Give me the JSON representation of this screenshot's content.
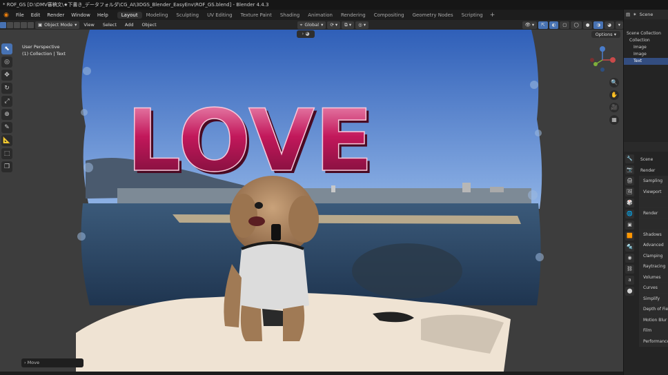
{
  "window": {
    "title": "* ROF_GS [D:\\DMV審稿文\\★下書き_データフォルダ\\CG_AI\\3DGS_Blender_EasyEnv\\ROF_GS.blend] - Blender 4.4.3"
  },
  "menus": [
    "File",
    "Edit",
    "Render",
    "Window",
    "Help"
  ],
  "workspaces": [
    "Layout",
    "Modeling",
    "Sculpting",
    "UV Editing",
    "Texture Paint",
    "Shading",
    "Animation",
    "Rendering",
    "Compositing",
    "Geometry Nodes",
    "Scripting"
  ],
  "active_workspace": "Layout",
  "header": {
    "mode": "Object Mode",
    "menus": [
      "View",
      "Select",
      "Add",
      "Object"
    ],
    "orientation": "Global",
    "options_label": "Options"
  },
  "viewport": {
    "view_name": "User Perspective",
    "collection_info": "(1) Collection | Text",
    "scene_text": "LOVE",
    "last_operator": "Move"
  },
  "outliner": {
    "scene_label": "Scene",
    "rows": [
      "Scene Collection",
      "Collection",
      "Image",
      "Image",
      "Text"
    ]
  },
  "properties": {
    "scene_label": "Scene",
    "rows": [
      "Render",
      "Sampling",
      "Viewport",
      "",
      "Render",
      "",
      "Shadows",
      "Advanced",
      "Clamping",
      "Raytracing",
      "Volumes",
      "Curves",
      "Simplify",
      "Depth of Field",
      "Motion Blur",
      "Film",
      "Performance"
    ]
  },
  "colors": {
    "accent": "#4772b3",
    "love_pink": "#c2185b",
    "sky": "#3f6fc4",
    "water": "#2f4a66"
  }
}
